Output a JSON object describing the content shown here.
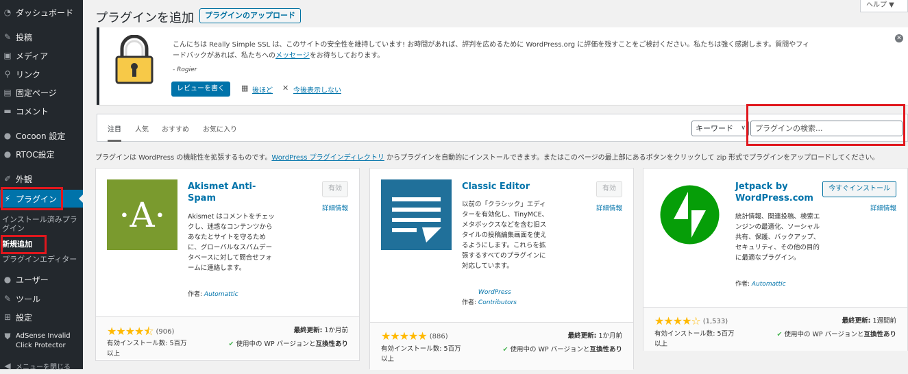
{
  "sidebar": {
    "items": [
      {
        "label": "ダッシュボード",
        "icon": "dashboard-icon",
        "glyph": "◔"
      },
      {
        "label": "投稿",
        "icon": "pin-icon",
        "glyph": "✎"
      },
      {
        "label": "メディア",
        "icon": "media-icon",
        "glyph": "▣"
      },
      {
        "label": "リンク",
        "icon": "link-icon",
        "glyph": "⚲"
      },
      {
        "label": "固定ページ",
        "icon": "page-icon",
        "glyph": "▤"
      },
      {
        "label": "コメント",
        "icon": "comment-icon",
        "glyph": "▬"
      },
      {
        "label": "Cocoon 設定",
        "icon": "cocoon-icon",
        "glyph": "●"
      },
      {
        "label": "RTOC設定",
        "icon": "rtoc-icon",
        "glyph": "●"
      },
      {
        "label": "外観",
        "icon": "appearance-icon",
        "glyph": "✐"
      },
      {
        "label": "プラグイン",
        "icon": "plugin-icon",
        "glyph": "⚡"
      },
      {
        "label": "ユーザー",
        "icon": "user-icon",
        "glyph": "●"
      },
      {
        "label": "ツール",
        "icon": "tool-icon",
        "glyph": "✎"
      },
      {
        "label": "設定",
        "icon": "settings-icon",
        "glyph": "⊞"
      },
      {
        "label": "AdSense Invalid Click Protector",
        "icon": "shield-icon",
        "glyph": "⛊"
      },
      {
        "label": "メニューを閉じる",
        "icon": "collapse-icon",
        "glyph": "◀"
      }
    ],
    "submenu": [
      "インストール済みプラグイン",
      "新規追加",
      "プラグインエディター"
    ]
  },
  "header": {
    "title": "プラグインを追加",
    "upload_label": "プラグインのアップロード",
    "help_label": "ヘルプ ▼"
  },
  "notice": {
    "text": "こんにちは Really Simple SSL は、このサイトの安全性を維持しています! お時間があれば、評判を広めるために WordPress.org に評価を残すことをご検討ください。私たちは強く感謝します。質問やフィードバックがあれば、私たちへの",
    "link": "メッセージ",
    "text_end": "をお待ちしております。",
    "signature": "- Rogier",
    "review_label": "レビューを書く",
    "later_label": "後ほど",
    "never_label": "今後表示しない",
    "lock_icon": "lock-icon"
  },
  "filter": {
    "tabs": [
      "注目",
      "人気",
      "おすすめ",
      "お気に入り"
    ],
    "keyword_label": "キーワード",
    "search_placeholder": "プラグインの検索..."
  },
  "description": {
    "before": "プラグインは WordPress の機能性を拡張するものです。",
    "link": "WordPress プラグインディレクトリ",
    "after": " からプラグインを自動的にインストールできます。またはこのページの最上部にあるボタンをクリックして zip 形式でプラグインをアップロードしてください。"
  },
  "plugins": [
    {
      "name": "Akismet Anti-Spam",
      "action": "有効",
      "more": "詳細情報",
      "desc": "Akismet はコメントをチェックし、迷惑なコンテンツからあなたとサイトを守るために、グローバルなスパムデータベースに対して問合せフォームに連絡します。",
      "author_label": "作者:",
      "author": "Automattic",
      "stars": "★★★★⯪",
      "rating_count": "(906)",
      "updated_label": "最終更新:",
      "updated": "1か月前",
      "installs": "有効インストール数: 5百万以上",
      "compat_text": "使用中の WP バージョンと",
      "compat_bold": "互換性あり",
      "thumb_color": "#7a9a2e"
    },
    {
      "name": "Classic Editor",
      "action": "有効",
      "more": "詳細情報",
      "desc": "以前の「クラシック」エディターを有効化し、TinyMCE、メタボックスなどを含む旧スタイルの投稿編集画面を使えるようにします。これらを拡張するすべてのプラグインに対応しています。",
      "author_label": "作者:",
      "author": "WordPress Contributors",
      "stars": "★★★★★",
      "rating_count": "(886)",
      "updated_label": "最終更新:",
      "updated": "1か月前",
      "installs": "有効インストール数: 5百万以上",
      "compat_text": "使用中の WP バージョンと",
      "compat_bold": "互換性あり",
      "thumb_color": "#20709a"
    },
    {
      "name": "Jetpack by WordPress.com",
      "action": "今すぐインストール",
      "more": "詳細情報",
      "desc": "統計情報、関連投稿、検索エンジンの最適化、ソーシャル共有、保護、バックアップ、セキュリティ、その他の目的に最適なプラグイン。",
      "author_label": "作者:",
      "author": "Automattic",
      "stars": "★★★★☆",
      "rating_count": "(1,533)",
      "updated_label": "最終更新:",
      "updated": "1週間前",
      "installs": "有効インストール数: 5百万以上",
      "compat_text": "使用中の WP バージョンと",
      "compat_bold": "互換性あり",
      "thumb_color": "#069e08"
    }
  ]
}
